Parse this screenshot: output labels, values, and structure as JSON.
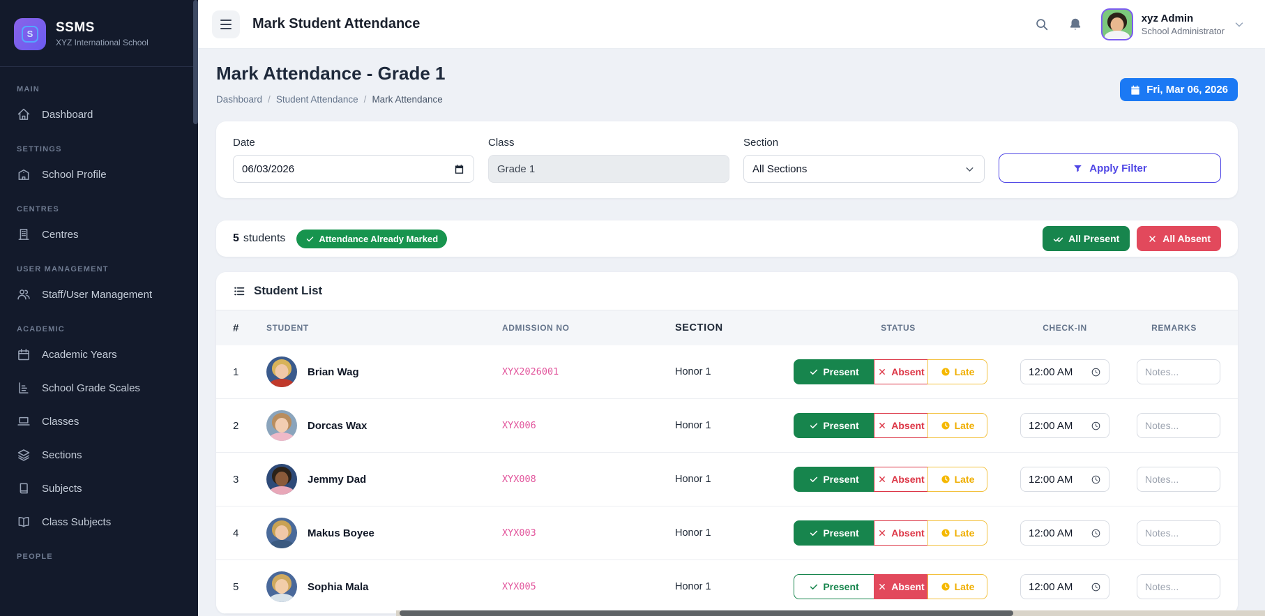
{
  "app": {
    "name": "SSMS",
    "subtitle": "XYZ International School"
  },
  "sidebar": {
    "sections": [
      {
        "label": "MAIN",
        "items": [
          {
            "icon": "home",
            "label": "Dashboard"
          }
        ]
      },
      {
        "label": "SETTINGS",
        "items": [
          {
            "icon": "school",
            "label": "School Profile"
          }
        ]
      },
      {
        "label": "CENTRES",
        "items": [
          {
            "icon": "building",
            "label": "Centres"
          }
        ]
      },
      {
        "label": "USER MANAGEMENT",
        "items": [
          {
            "icon": "users",
            "label": "Staff/User Management"
          }
        ]
      },
      {
        "label": "ACADEMIC",
        "items": [
          {
            "icon": "calendar",
            "label": "Academic Years"
          },
          {
            "icon": "scales",
            "label": "School Grade Scales"
          },
          {
            "icon": "laptop",
            "label": "Classes"
          },
          {
            "icon": "layers",
            "label": "Sections"
          },
          {
            "icon": "book",
            "label": "Subjects"
          },
          {
            "icon": "openbook",
            "label": "Class Subjects"
          }
        ]
      },
      {
        "label": "PEOPLE",
        "items": []
      }
    ]
  },
  "header": {
    "title": "Mark Student Attendance",
    "user": {
      "name": "xyz Admin",
      "role": "School Administrator"
    }
  },
  "page": {
    "title": "Mark Attendance - Grade 1",
    "breadcrumb": [
      "Dashboard",
      "Student Attendance",
      "Mark Attendance"
    ],
    "date_badge": "Fri, Mar 06, 2026"
  },
  "filters": {
    "date_label": "Date",
    "date_value": "06/03/2026",
    "class_label": "Class",
    "class_value": "Grade 1",
    "section_label": "Section",
    "section_value": "All Sections",
    "apply_label": "Apply Filter"
  },
  "summary": {
    "count": "5",
    "count_suffix": "students",
    "marked_badge": "Attendance Already Marked",
    "all_present_label": "All Present",
    "all_absent_label": "All Absent"
  },
  "table": {
    "title": "Student List",
    "columns": [
      "#",
      "STUDENT",
      "ADMISSION NO",
      "SECTION",
      "STATUS",
      "CHECK-IN",
      "REMARKS"
    ],
    "status_labels": {
      "present": "Present",
      "absent": "Absent",
      "late": "Late"
    },
    "checkin_value": "12:00 AM",
    "remarks_placeholder": "Notes...",
    "students": [
      {
        "num": "1",
        "name": "Brian Wag",
        "admission_no": "XYX2026001",
        "section": "Honor 1",
        "status": "present",
        "avatar": {
          "bg": "#3a5a8c",
          "hair": "#d8b35a",
          "skin": "#f0c8a8",
          "shirt": "#c0392b"
        }
      },
      {
        "num": "2",
        "name": "Dorcas Wax",
        "admission_no": "XYX006",
        "section": "Honor 1",
        "status": "present",
        "avatar": {
          "bg": "#8aa4bc",
          "hair": "#b98d5e",
          "skin": "#f2cdb2",
          "shirt": "#efb9c8"
        }
      },
      {
        "num": "3",
        "name": "Jemmy Dad",
        "admission_no": "XYX008",
        "section": "Honor 1",
        "status": "present",
        "avatar": {
          "bg": "#2e4a78",
          "hair": "#2b2118",
          "skin": "#8a5a3a",
          "shirt": "#e8a7b8"
        }
      },
      {
        "num": "4",
        "name": "Makus Boyee",
        "admission_no": "XYX003",
        "section": "Honor 1",
        "status": "present",
        "avatar": {
          "bg": "#4a6a9a",
          "hair": "#c9a254",
          "skin": "#f0c8a8",
          "shirt": "#3b5a80"
        }
      },
      {
        "num": "5",
        "name": "Sophia Mala",
        "admission_no": "XYX005",
        "section": "Honor 1",
        "status": "absent",
        "avatar": {
          "bg": "#49689a",
          "hair": "#cfa95e",
          "skin": "#f2cda9",
          "shirt": "#d8e2ea"
        }
      }
    ]
  },
  "colors": {
    "sidebar_bg": "#131a2b",
    "accent_blue": "#1b79f4",
    "green": "#17854d",
    "badge_green": "#17944e",
    "red": "#e2495c",
    "absent_red": "#dc3545",
    "amber": "#f3c13d",
    "indigo": "#4f46e5",
    "admission_pink": "#e2559c"
  }
}
